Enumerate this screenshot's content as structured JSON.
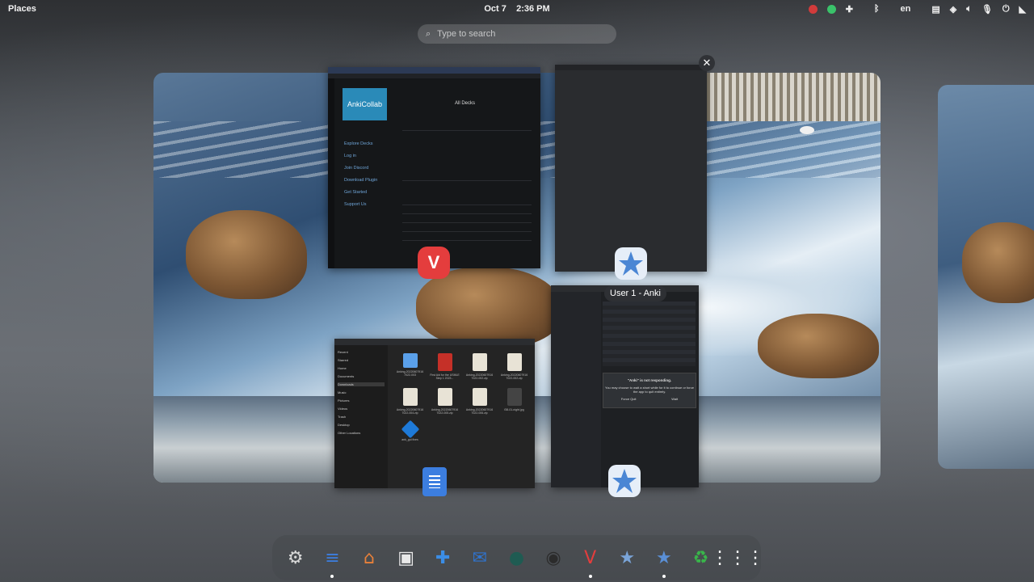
{
  "topbar": {
    "activities": "Places",
    "date": "Oct 7",
    "time": "2:36 PM",
    "input_source": "en"
  },
  "search": {
    "placeholder": "Type to search"
  },
  "windows": {
    "vivaldi": {
      "logo_text": "AnkiCollab",
      "heading": "All Decks",
      "nav": [
        "Explore Decks",
        "Log in",
        "Join Discord",
        "Download Plugin",
        "Get Started",
        "Support Us"
      ]
    },
    "anki_main": {
      "title": "User 1 - Anki"
    },
    "files": {
      "sidebar": [
        "Recent",
        "Starred",
        "Home",
        "Documents",
        "Downloads",
        "Music",
        "Pictures",
        "Videos",
        "Trash",
        "Desktop",
        "Other Locations"
      ],
      "items": [
        "Anking-20220607916 7022-003",
        "First Aid for the USMLE Step 1 2023...",
        "Anking-20220607916 7022-002.zip",
        "Anking-20220607916 7022-002.zip",
        "Anking-20220607916 7022-004.zip",
        "Anking-20220607916 7022-005.zip",
        "Anking-20220607916 7022-006.zip",
        "f38-01-night.jpg",
        "ank_gui fixes"
      ]
    },
    "anki_browse": {
      "dialog_title": "\"Anki\" is not responding.",
      "dialog_text": "You may choose to wait a short while for it to continue or force the app to quit entirely.",
      "force_quit": "Force Quit",
      "wait": "Wait"
    }
  },
  "tooltip": "User 1 - Anki",
  "close_symbol": "✕",
  "dock": [
    {
      "name": "settings-app-icon",
      "glyph": "⚙",
      "color": "#d8d8d8",
      "running": false
    },
    {
      "name": "text-editor-app-icon",
      "glyph": "≡",
      "color": "#3c7ee0",
      "running": true
    },
    {
      "name": "software-store-app-icon",
      "glyph": "⌂",
      "color": "#e8803a",
      "running": false
    },
    {
      "name": "flathub-app-icon",
      "glyph": "▣",
      "color": "#e9e9e9",
      "running": false
    },
    {
      "name": "extensions-app-icon",
      "glyph": "✚",
      "color": "#3b8de6",
      "running": false
    },
    {
      "name": "thunderbird-app-icon",
      "glyph": "✉",
      "color": "#2f74d0",
      "running": false
    },
    {
      "name": "discord-like-app-icon",
      "glyph": "●",
      "color": "#1f5b52",
      "running": false
    },
    {
      "name": "obs-app-icon",
      "glyph": "◉",
      "color": "#2b2b2b",
      "running": false
    },
    {
      "name": "vivaldi-app-icon",
      "glyph": "V",
      "color": "#e43d3d",
      "running": true
    },
    {
      "name": "star-app-icon",
      "glyph": "★",
      "color": "#7aa4d8",
      "running": false
    },
    {
      "name": "anki-app-icon",
      "glyph": "★",
      "color": "#5a8fd6",
      "running": true
    },
    {
      "name": "trash-app-icon",
      "glyph": "♻",
      "color": "#39b54a",
      "running": false
    },
    {
      "name": "app-grid-icon",
      "glyph": "⋮⋮⋮",
      "color": "#ffffff",
      "running": false
    }
  ]
}
